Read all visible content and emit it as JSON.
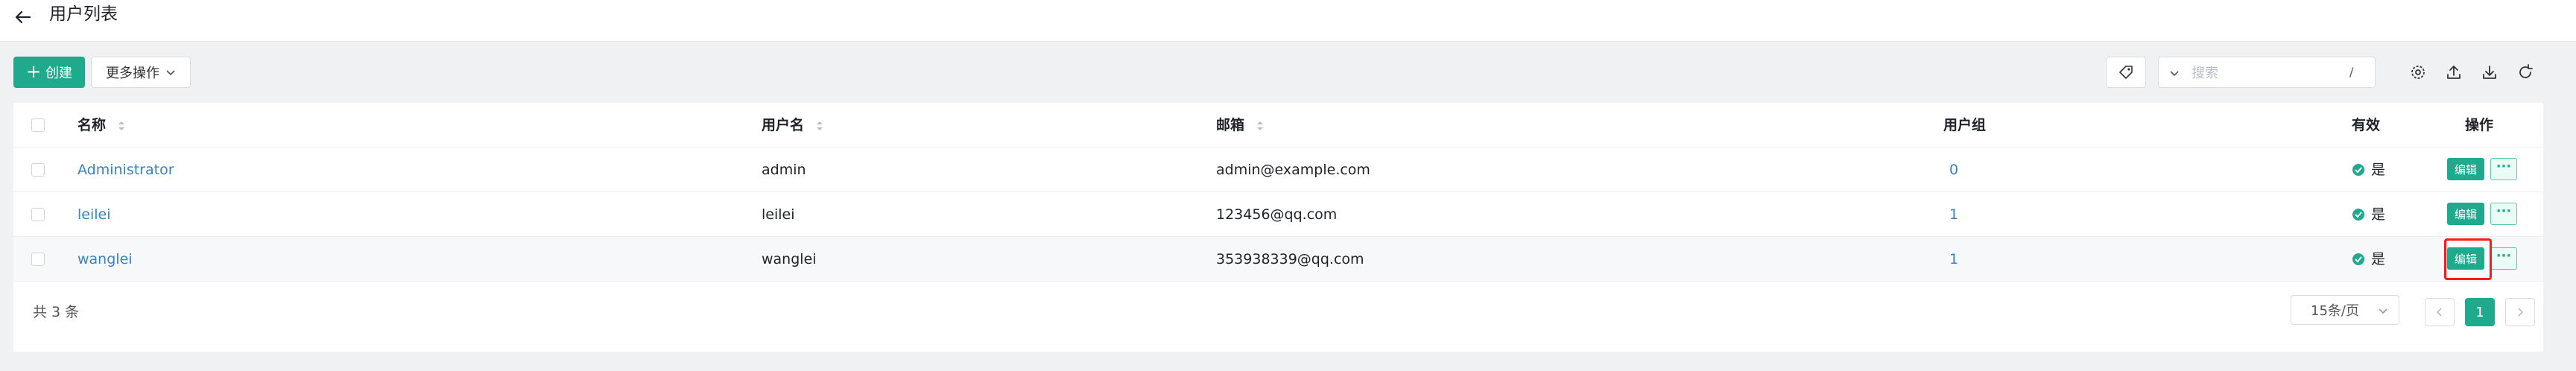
{
  "header": {
    "title": "用户列表"
  },
  "toolbar": {
    "create_label": "创建",
    "more_label": "更多操作",
    "search_placeholder": "搜索",
    "search_shortcut": "/"
  },
  "table": {
    "columns": {
      "name": "名称",
      "username": "用户名",
      "email": "邮箱",
      "group": "用户组",
      "valid": "有效",
      "actions": "操作"
    },
    "rows": [
      {
        "name": "Administrator",
        "username": "admin",
        "email": "admin@example.com",
        "group": "0",
        "valid": "是",
        "edit_label": "编辑",
        "more_label": "···"
      },
      {
        "name": "leilei",
        "username": "leilei",
        "email": "123456@qq.com",
        "group": "1",
        "valid": "是",
        "edit_label": "编辑",
        "more_label": "···"
      },
      {
        "name": "wanglei",
        "username": "wanglei",
        "email": "353938339@qq.com",
        "group": "1",
        "valid": "是",
        "edit_label": "编辑",
        "more_label": "···"
      }
    ]
  },
  "footer": {
    "total": "共 3 条",
    "page_size": "15条/页",
    "current_page": "1"
  },
  "colors": {
    "primary": "#1fa98d",
    "link": "#3a82c4",
    "highlight": "#ff1a1a"
  }
}
